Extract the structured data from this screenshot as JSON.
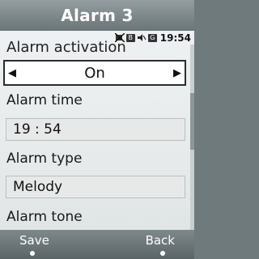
{
  "title": "Alarm 3",
  "status": {
    "icons": [
      "no-sim-icon",
      "message-icon",
      "muted-speaker-icon",
      "signal-icon"
    ],
    "time": "19:54"
  },
  "clipped_label": "Alarm activation",
  "activation": {
    "value": "On"
  },
  "alarm_time": {
    "label": "Alarm time",
    "value": "19 : 54"
  },
  "alarm_type": {
    "label": "Alarm type",
    "value": "Melody"
  },
  "alarm_tone": {
    "label": "Alarm tone"
  },
  "softkeys": {
    "left": "Save",
    "right": "Back"
  },
  "colors": {
    "title_bar": "#7d888a",
    "background": "#e8ecec",
    "field": "#e7e9e9",
    "selector_border": "#2c2c2c"
  }
}
